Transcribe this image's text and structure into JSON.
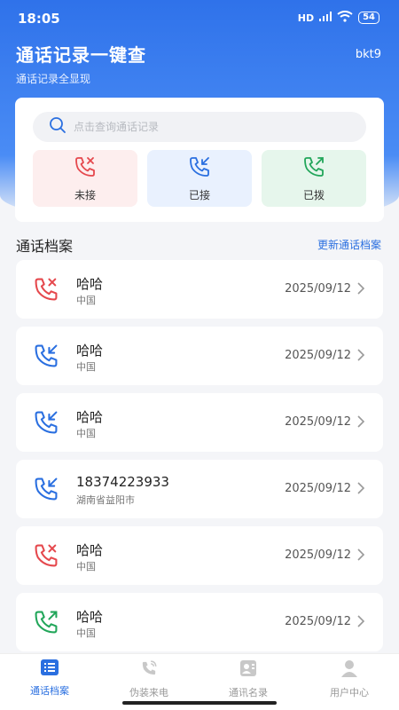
{
  "status": {
    "time": "18:05",
    "network": "HD",
    "battery": "54"
  },
  "header": {
    "title": "通话记录一键查",
    "subtitle": "通话记录全显现",
    "user": "bkt9"
  },
  "search": {
    "placeholder": "点击查询通话记录",
    "value": ""
  },
  "filters": [
    {
      "label": "未接",
      "icon": "missed-call-icon",
      "color": "#e5484d"
    },
    {
      "label": "已接",
      "icon": "incoming-call-icon",
      "color": "#2a6fe0"
    },
    {
      "label": "已拨",
      "icon": "outgoing-call-icon",
      "color": "#22a65a"
    }
  ],
  "section": {
    "title": "通话档案",
    "action": "更新通话档案"
  },
  "calls": [
    {
      "name": "哈哈",
      "location": "中国",
      "date": "2025/09/12",
      "type": "missed"
    },
    {
      "name": "哈哈",
      "location": "中国",
      "date": "2025/09/12",
      "type": "incoming"
    },
    {
      "name": "哈哈",
      "location": "中国",
      "date": "2025/09/12",
      "type": "incoming"
    },
    {
      "name": "18374223933",
      "location": "湖南省益阳市",
      "date": "2025/09/12",
      "type": "incoming"
    },
    {
      "name": "哈哈",
      "location": "中国",
      "date": "2025/09/12",
      "type": "missed"
    },
    {
      "name": "哈哈",
      "location": "中国",
      "date": "2025/09/12",
      "type": "outgoing"
    }
  ],
  "tabs": [
    {
      "label": "通话档案",
      "icon": "list-icon",
      "active": true
    },
    {
      "label": "伪装来电",
      "icon": "phone-ring-icon",
      "active": false
    },
    {
      "label": "通讯名录",
      "icon": "contacts-icon",
      "active": false
    },
    {
      "label": "用户中心",
      "icon": "user-icon",
      "active": false
    }
  ],
  "colors": {
    "primary": "#2f72ea",
    "missed": "#e5484d",
    "incoming": "#2a6fe0",
    "outgoing": "#22a65a"
  }
}
